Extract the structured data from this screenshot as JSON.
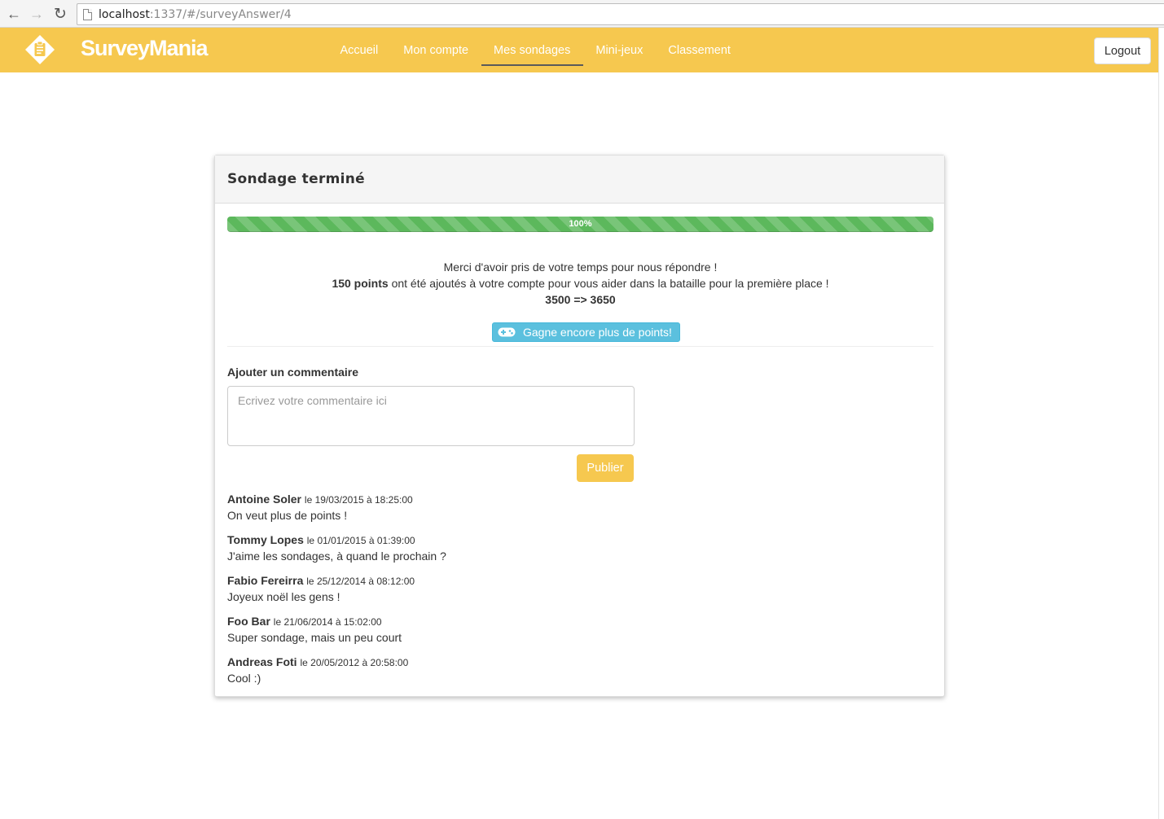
{
  "browser": {
    "url_host": "localhost",
    "url_path": ":1337/#/surveyAnswer/4"
  },
  "navbar": {
    "brand": "SurveyMania",
    "links": [
      "Accueil",
      "Mon compte",
      "Mes sondages",
      "Mini-jeux",
      "Classement"
    ],
    "active_link": "Mes sondages",
    "logout_label": "Logout"
  },
  "colors": {
    "brand_yellow": "#f6c84f",
    "progress_green": "#5cb85c",
    "info_blue": "#5bc0de"
  },
  "panel": {
    "title": "Sondage terminé",
    "progress": {
      "value": 100,
      "label": "100%"
    },
    "thanks_line": "Merci d'avoir pris de votre temps pour nous répondre !",
    "points_bold": "150 points",
    "points_rest": " ont été ajoutés à votre compte pour vous aider dans la bataille pour la première place !",
    "score_change": "3500 => 3650",
    "game_button_label": "Gagne encore plus de points!",
    "game_button_icon": "gamepad-icon",
    "comment_label": "Ajouter un commentaire",
    "comment_placeholder": "Ecrivez votre commentaire ici",
    "comment_value": "",
    "publish_label": "Publier"
  },
  "comments": [
    {
      "author": "Antoine Soler",
      "date": "le 19/03/2015 à 18:25:00",
      "text": "On veut plus de points !"
    },
    {
      "author": "Tommy Lopes",
      "date": "le 01/01/2015 à 01:39:00",
      "text": "J'aime les sondages, à quand le prochain ?"
    },
    {
      "author": "Fabio Fereirra",
      "date": "le 25/12/2014 à 08:12:00",
      "text": "Joyeux noël les gens !"
    },
    {
      "author": "Foo Bar",
      "date": "le 21/06/2014 à 15:02:00",
      "text": "Super sondage, mais un peu court"
    },
    {
      "author": "Andreas Foti",
      "date": "le 20/05/2012 à 20:58:00",
      "text": "Cool :)"
    }
  ]
}
